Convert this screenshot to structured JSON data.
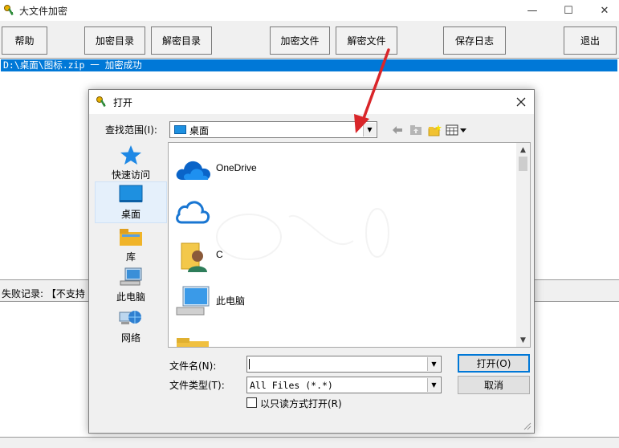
{
  "window": {
    "title": "大文件加密",
    "minimize_glyph": "—",
    "maximize_glyph": "☐",
    "close_glyph": "✕"
  },
  "toolbar": {
    "help": "帮助",
    "encrypt_dir": "加密目录",
    "decrypt_dir": "解密目录",
    "encrypt_file": "加密文件",
    "decrypt_file": "解密文件",
    "save_log": "保存日志",
    "exit": "退出"
  },
  "log": {
    "rows": [
      "D:\\桌面\\图标.zip 一 加密成功"
    ]
  },
  "fail": {
    "label": "失败记录: 【不支持"
  },
  "dialog": {
    "title": "打开",
    "look_in_label": "查找范围(I):",
    "look_in_value": "桌面",
    "places": [
      "快速访问",
      "桌面",
      "库",
      "此电脑",
      "网络"
    ],
    "files": [
      "OneDrive",
      "",
      "C",
      "此电脑"
    ],
    "filename_label": "文件名(N):",
    "filename_value": "",
    "filetype_label": "文件类型(T):",
    "filetype_value": "All Files (*.*)",
    "open_button": "打开(O)",
    "cancel_button": "取消",
    "readonly_label": "以只读方式打开(R)"
  },
  "colors": {
    "selection": "#0078d7",
    "arrow": "#d9262a",
    "onedrive": "#0a64c8"
  },
  "icons": {
    "app": "key-icon",
    "lookin": "desktop-icon",
    "back": "back-arrow-icon",
    "up": "up-folder-icon",
    "new_folder": "new-folder-icon",
    "view": "view-menu-icon"
  }
}
